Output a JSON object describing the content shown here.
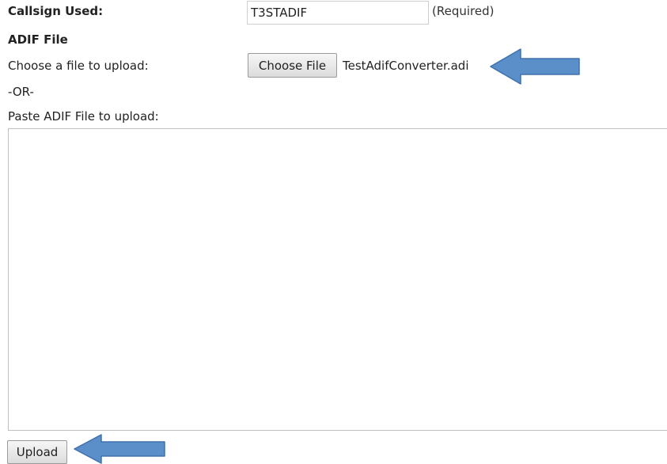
{
  "form": {
    "callsign_label": "Callsign Used:",
    "callsign_value": "T3STADIF",
    "callsign_required": "(Required)",
    "adif_heading": "ADIF File",
    "choose_label": "Choose a file to upload:",
    "choose_button_label": "Choose File",
    "chosen_file_name": "TestAdifConverter.adi",
    "or_text": "-OR-",
    "paste_label": "Paste ADIF File to upload:",
    "paste_value": "",
    "upload_button_label": "Upload"
  },
  "annotations": {
    "arrow_color": "#5b8fc9",
    "arrow_outline_color": "#3f72ad",
    "arrow_icon": "left-arrow-icon"
  }
}
